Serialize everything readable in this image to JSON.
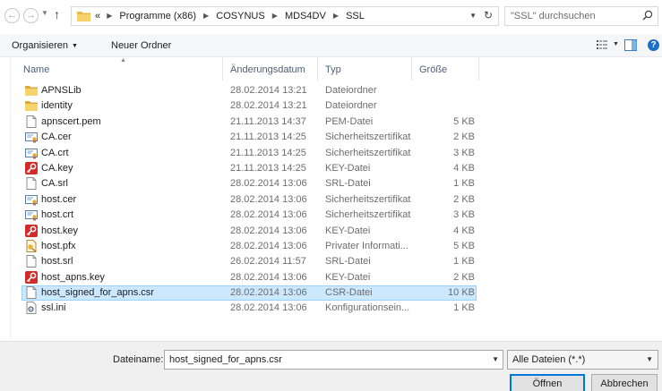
{
  "nav": {
    "back_icon": "back-arrow-icon",
    "forward_icon": "forward-arrow-icon",
    "up_icon": "up-arrow-icon",
    "back_glyph": "←",
    "forward_glyph": "→",
    "up_glyph": "↑"
  },
  "address": {
    "overflow": "«",
    "breadcrumbs": [
      "Programme (x86)",
      "COSYNUS",
      "MDS4DV",
      "SSL"
    ]
  },
  "search": {
    "placeholder": "\"SSL\" durchsuchen"
  },
  "toolbar": {
    "organize_label": "Organisieren",
    "new_folder_label": "Neuer Ordner"
  },
  "columns": {
    "name": "Name",
    "date": "Änderungsdatum",
    "type": "Typ",
    "size": "Größe"
  },
  "files": [
    {
      "name": "APNSLib",
      "date": "28.02.2014 13:21",
      "type": "Dateiordner",
      "size": "",
      "icon": "folder"
    },
    {
      "name": "identity",
      "date": "28.02.2014 13:21",
      "type": "Dateiordner",
      "size": "",
      "icon": "folder"
    },
    {
      "name": "apnscert.pem",
      "date": "21.11.2013 14:37",
      "type": "PEM-Datei",
      "size": "5 KB",
      "icon": "file"
    },
    {
      "name": "CA.cer",
      "date": "21.11.2013 14:25",
      "type": "Sicherheitszertifikat",
      "size": "2 KB",
      "icon": "certificate"
    },
    {
      "name": "CA.crt",
      "date": "21.11.2013 14:25",
      "type": "Sicherheitszertifikat",
      "size": "3 KB",
      "icon": "certificate"
    },
    {
      "name": "CA.key",
      "date": "21.11.2013 14:25",
      "type": "KEY-Datei",
      "size": "4 KB",
      "icon": "key"
    },
    {
      "name": "CA.srl",
      "date": "28.02.2014 13:06",
      "type": "SRL-Datei",
      "size": "1 KB",
      "icon": "file"
    },
    {
      "name": "host.cer",
      "date": "28.02.2014 13:06",
      "type": "Sicherheitszertifikat",
      "size": "2 KB",
      "icon": "certificate"
    },
    {
      "name": "host.crt",
      "date": "28.02.2014 13:06",
      "type": "Sicherheitszertifikat",
      "size": "3 KB",
      "icon": "certificate"
    },
    {
      "name": "host.key",
      "date": "28.02.2014 13:06",
      "type": "KEY-Datei",
      "size": "4 KB",
      "icon": "key"
    },
    {
      "name": "host.pfx",
      "date": "28.02.2014 13:06",
      "type": "Privater Informati...",
      "size": "5 KB",
      "icon": "pfx"
    },
    {
      "name": "host.srl",
      "date": "26.02.2014 11:57",
      "type": "SRL-Datei",
      "size": "1 KB",
      "icon": "file"
    },
    {
      "name": "host_apns.key",
      "date": "28.02.2014 13:06",
      "type": "KEY-Datei",
      "size": "2 KB",
      "icon": "key"
    },
    {
      "name": "host_signed_for_apns.csr",
      "date": "28.02.2014 13:06",
      "type": "CSR-Datei",
      "size": "10 KB",
      "icon": "file",
      "selected": true
    },
    {
      "name": "ssl.ini",
      "date": "28.02.2014 13:06",
      "type": "Konfigurationsein...",
      "size": "1 KB",
      "icon": "ini"
    }
  ],
  "bottom": {
    "filename_label": "Dateiname:",
    "filename_value": "host_signed_for_apns.csr",
    "filter_value": "Alle Dateien (*.*)",
    "open_label": "Öffnen",
    "cancel_label": "Abbrechen"
  },
  "colors": {
    "selection_bg": "#cce8ff",
    "selection_border": "#99d1ff",
    "header_text": "#4c607a",
    "accent": "#0078d7"
  }
}
